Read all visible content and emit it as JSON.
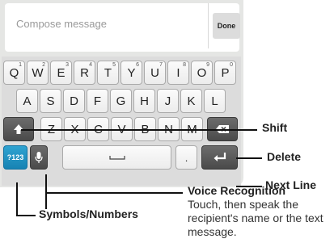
{
  "compose": {
    "placeholder": "Compose message",
    "done_label": "Done"
  },
  "keyboard": {
    "row1": [
      {
        "label": "Q",
        "hint": "1"
      },
      {
        "label": "W",
        "hint": "2"
      },
      {
        "label": "E",
        "hint": "3"
      },
      {
        "label": "R",
        "hint": "4"
      },
      {
        "label": "T",
        "hint": "5"
      },
      {
        "label": "Y",
        "hint": "6"
      },
      {
        "label": "U",
        "hint": "7"
      },
      {
        "label": "I",
        "hint": "8"
      },
      {
        "label": "O",
        "hint": "9"
      },
      {
        "label": "P",
        "hint": "0"
      }
    ],
    "row2": [
      "A",
      "S",
      "D",
      "F",
      "G",
      "H",
      "J",
      "K",
      "L"
    ],
    "row3": [
      "Z",
      "X",
      "C",
      "V",
      "B",
      "N",
      "M"
    ],
    "symbols_label": "?123",
    "period_label": "."
  },
  "callouts": {
    "shift": "Shift",
    "delete": "Delete",
    "next_line": "Next Line",
    "voice_recognition": "Voice Recognition",
    "voice_desc": "Touch, then speak the recipient's name or the text message.",
    "symbols_numbers": "Symbols/Numbers"
  },
  "colors": {
    "accent": "#1783b3",
    "dark_key": "#4a4a4a",
    "keyboard_bg": "#dcdcdc"
  }
}
